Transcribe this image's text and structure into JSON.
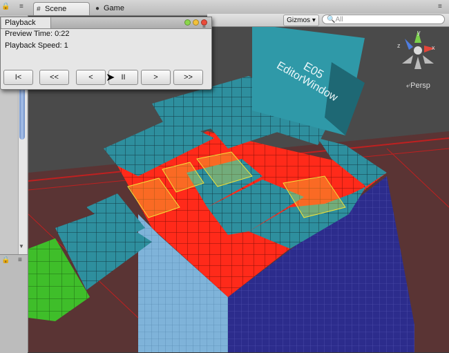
{
  "tabs": {
    "scene_label": "Scene",
    "game_label": "Game"
  },
  "scene_toolbar": {
    "gizmos_label": "Gizmos",
    "search_placeholder": "All",
    "perspective_label": "Persp"
  },
  "scene_content": {
    "sign_line1": "E05",
    "sign_line2": "EditorWindow",
    "gizmo_axes": [
      "y",
      "x",
      "z"
    ]
  },
  "playback_window": {
    "tab_label": "Playback",
    "preview_time": "Preview Time: 0:22",
    "playback_speed": "Playback Speed: 1",
    "buttons": [
      "I<",
      "<<",
      "<",
      "II",
      ">",
      ">>"
    ]
  },
  "colors": {
    "cube_teal": "#2e8f9e",
    "cube_red": "#ff2a1a",
    "cube_green": "#3fbe2a",
    "cube_blue": "#2a2a8f",
    "highlight_yellow": "#f2e33a"
  },
  "icons": {
    "scene_tab": "scene-hash-icon",
    "game_tab": "game-pacman-icon",
    "cursor": "mouse-pointer-icon"
  }
}
